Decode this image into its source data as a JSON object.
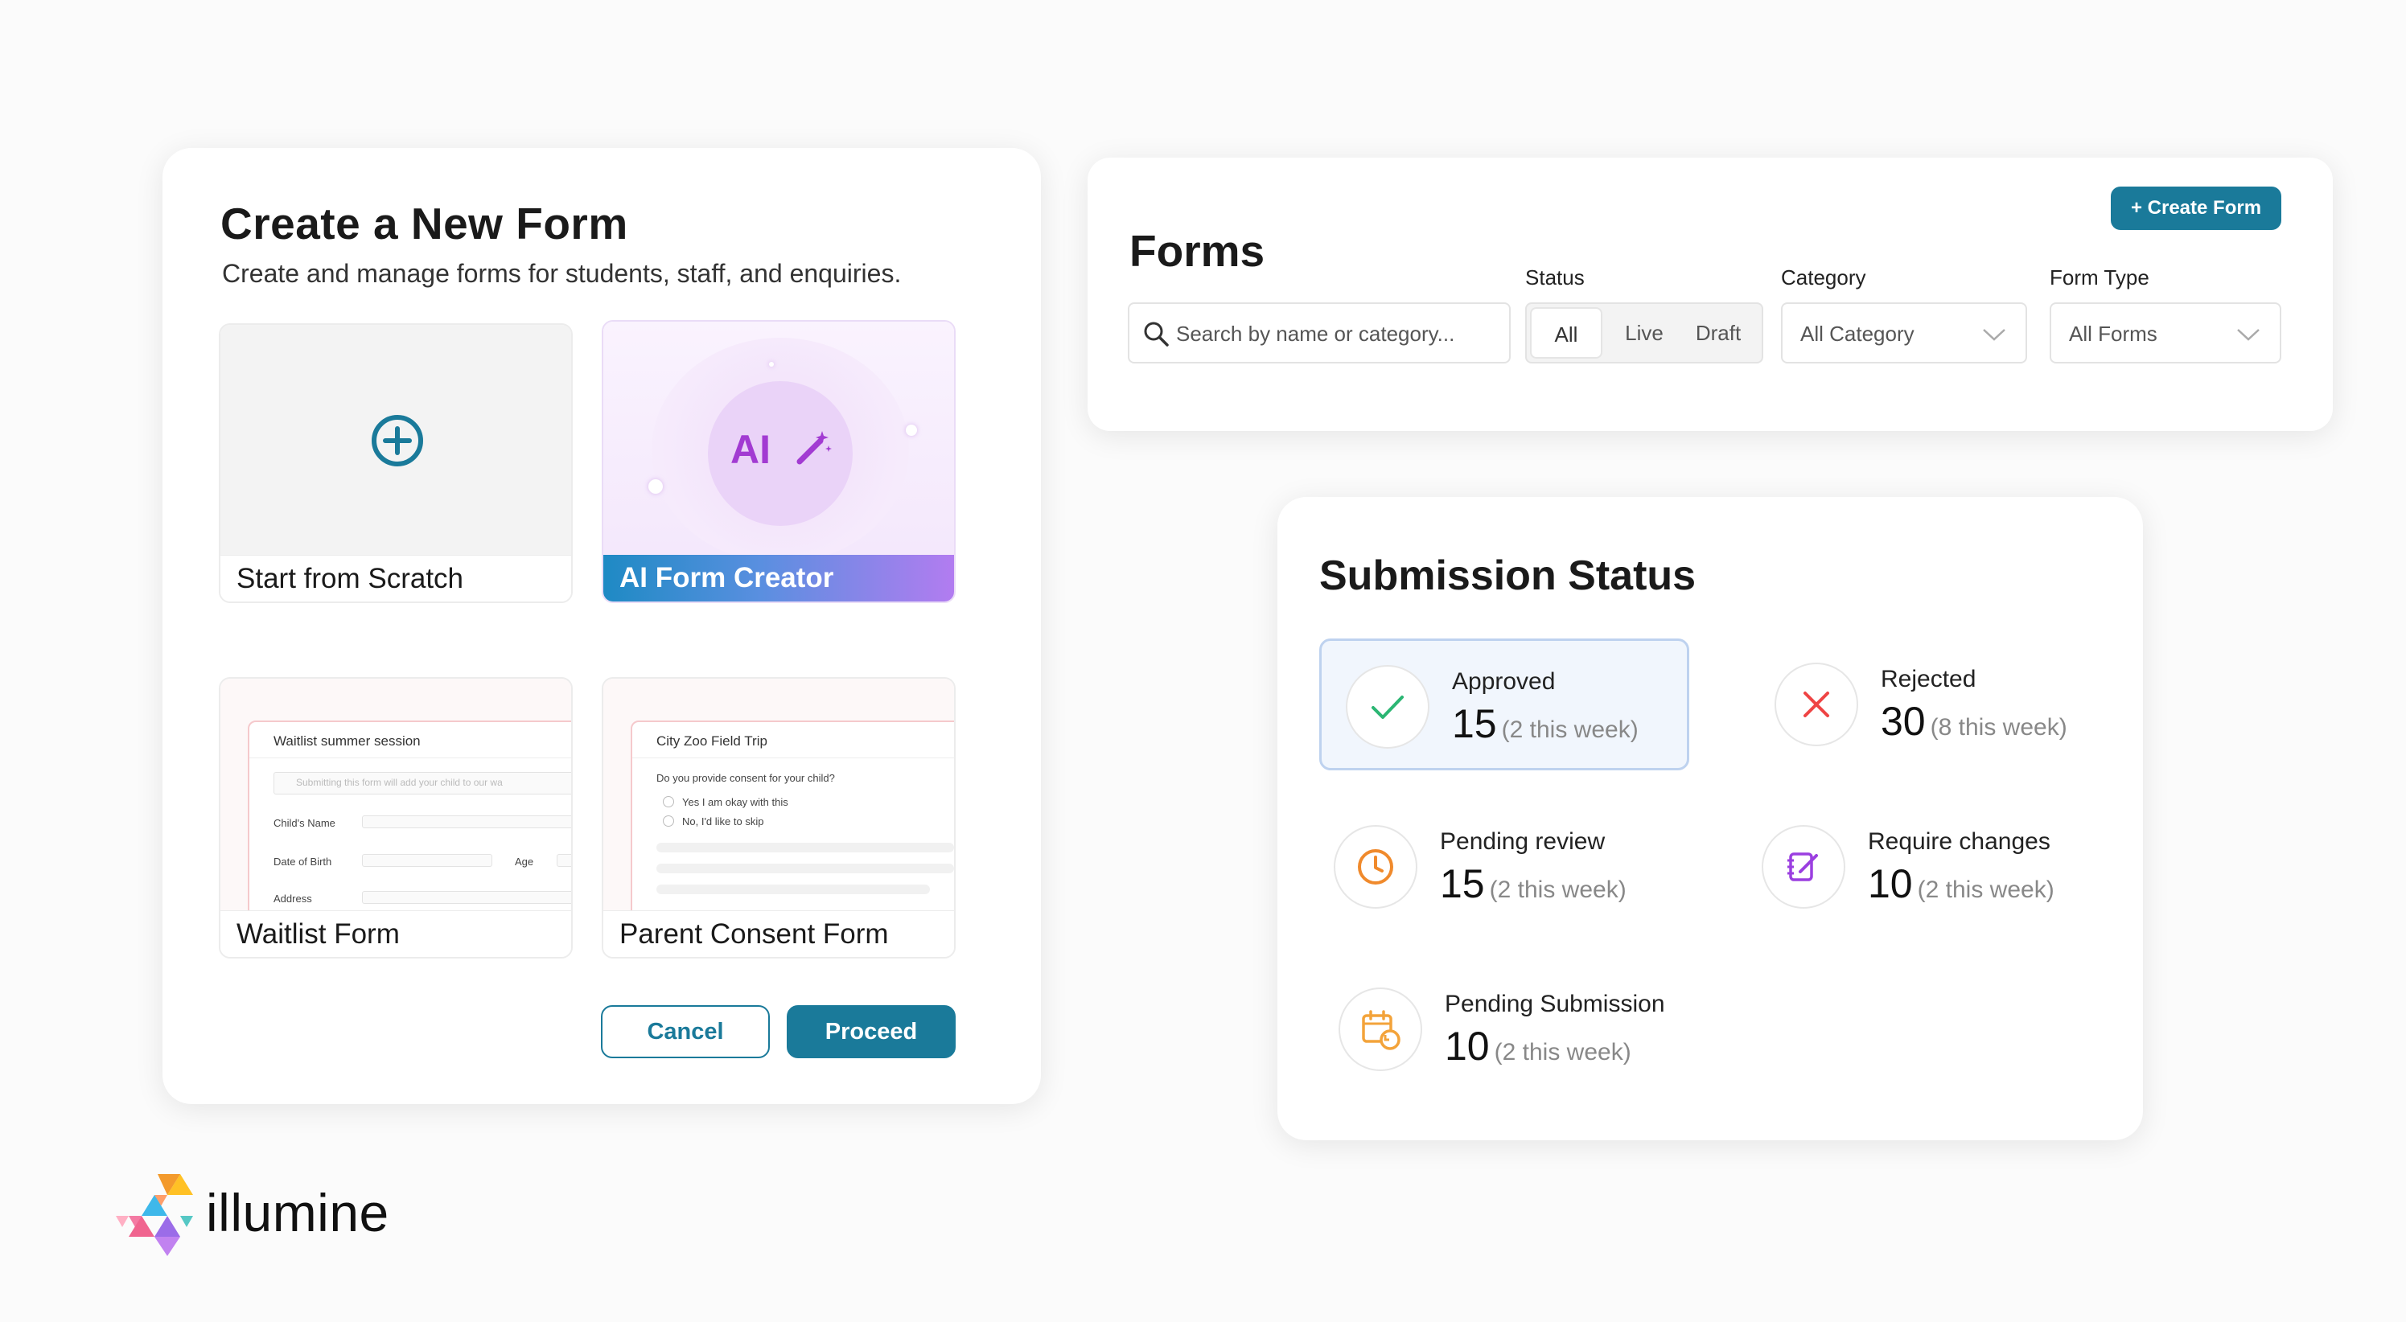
{
  "create_form": {
    "title": "Create a New Form",
    "subtitle": "Create and manage forms for students, staff, and enquiries.",
    "templates": [
      {
        "label": "Start from Scratch",
        "icon": "plus-circle-icon"
      },
      {
        "label": "AI Form Creator",
        "icon_text": "AI"
      },
      {
        "label": "Waitlist Form",
        "preview": {
          "title": "Waitlist summer session",
          "note": "Submitting this form will add your child to our wa",
          "fields": [
            "Child's Name",
            "Date of Birth",
            "Age",
            "Address"
          ]
        }
      },
      {
        "label": "Parent Consent Form",
        "preview": {
          "title": "City Zoo Field Trip",
          "question": "Do you provide consent for your child?",
          "options": [
            "Yes I am okay with this",
            "No, I'd like to skip"
          ]
        }
      }
    ],
    "cancel_label": "Cancel",
    "proceed_label": "Proceed"
  },
  "forms": {
    "title": "Forms",
    "create_button": "+ Create Form",
    "search_placeholder": "Search by name or category...",
    "status_label": "Status",
    "status_options": [
      "All",
      "Live",
      "Draft"
    ],
    "status_selected": "All",
    "category_label": "Category",
    "category_value": "All Category",
    "form_type_label": "Form Type",
    "form_type_value": "All Forms"
  },
  "submission": {
    "title": "Submission Status",
    "stats": [
      {
        "label": "Approved",
        "count": "15",
        "week": "(2 this week)",
        "icon": "check-icon",
        "color": "#2bb673"
      },
      {
        "label": "Rejected",
        "count": "30",
        "week": "(8 this week)",
        "icon": "x-icon",
        "color": "#ef4444"
      },
      {
        "label": "Pending review",
        "count": "15",
        "week": "(2 this week)",
        "icon": "clock-icon",
        "color": "#f08a2c"
      },
      {
        "label": "Require changes",
        "count": "10",
        "week": "(2 this week)",
        "icon": "edit-note-icon",
        "color": "#9b3fe0"
      },
      {
        "label": "Pending Submission",
        "count": "10",
        "week": "(2 this week)",
        "icon": "calendar-refresh-icon",
        "color": "#f3a33a"
      }
    ]
  },
  "brand": {
    "name": "illumine",
    "accent": "#1a7a9a"
  }
}
